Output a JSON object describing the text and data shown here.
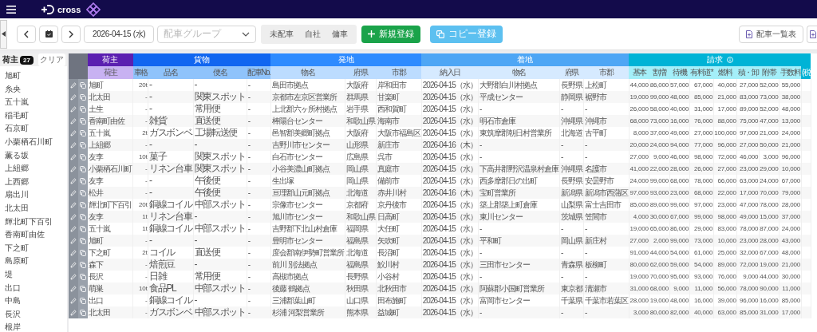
{
  "topbar": {
    "logo_text": "cross"
  },
  "toolbar": {
    "date": "2026-04-15 (水)",
    "group_select": {
      "placeholder": "配車グループ"
    },
    "segments": [
      {
        "label": "未配車",
        "selected": false
      },
      {
        "label": "自社",
        "selected": false
      },
      {
        "label": "傭車",
        "selected": false
      }
    ],
    "new_button": "新規登録",
    "copy_button": "コピー登録",
    "list_button": "配車一覧表"
  },
  "sidebar": {
    "title": "荷主",
    "count": "27",
    "clear_button": "クリア",
    "items": [
      "旭町",
      "糸央",
      "五十嵐",
      "稲毛町",
      "石京町",
      "小栗栖石川町",
      "薫る坂",
      "上組郷",
      "上西郷",
      "扇出川",
      "北太田",
      "輝北町下百引",
      "香南町由佐",
      "下之町",
      "島原町",
      "堤",
      "出口",
      "中島",
      "長沢",
      "根岸"
    ]
  },
  "table": {
    "column_groups": [
      {
        "label": "荷主",
        "kind": "shipper",
        "columns": [
          {
            "label": "荷主",
            "kind": "text"
          }
        ]
      },
      {
        "label": "貨物",
        "kind": "cargo",
        "columns": [
          {
            "label": "車格",
            "kind": "number"
          },
          {
            "label": "品名",
            "kind": "label"
          },
          {
            "label": "便名",
            "kind": "label"
          },
          {
            "label": "配車No.",
            "kind": "text"
          }
        ]
      },
      {
        "label": "発地",
        "kind": "origin",
        "columns": [
          {
            "label": "物名",
            "kind": "text"
          },
          {
            "label": "府県",
            "kind": "text"
          },
          {
            "label": "市郡",
            "kind": "text"
          }
        ]
      },
      {
        "label": "着地",
        "kind": "destination",
        "columns": [
          {
            "label": "納入日",
            "kind": "text"
          },
          {
            "label": "物名",
            "kind": "text"
          },
          {
            "label": "府県",
            "kind": "text"
          },
          {
            "label": "市郡",
            "kind": "text"
          }
        ]
      },
      {
        "label": "請求",
        "kind": "billing",
        "columns": [
          {
            "label": "基本",
            "kind": "number"
          },
          {
            "label": "割増",
            "kind": "number"
          },
          {
            "label": "待機",
            "kind": "number"
          },
          {
            "label": "有料道*",
            "kind": "number"
          },
          {
            "label": "燃料",
            "kind": "number"
          },
          {
            "label": "積・卸",
            "kind": "number"
          },
          {
            "label": "附帯",
            "kind": "number"
          },
          {
            "label": "手数料",
            "kind": "number"
          }
        ]
      }
    ],
    "tax_column": "(税",
    "rows": [
      [
        "旭町",
        "20t",
        "-",
        "-",
        "-",
        "島田市拠点",
        "大阪府",
        "岸和田市",
        "2026-04-15（水）",
        "大野郡白川村拠点",
        "長野県",
        "上松町",
        "44,000",
        "86,000",
        "57,000",
        "67,000",
        "40,000",
        "27,000",
        "52,000",
        "55,000"
      ],
      [
        "北太田",
        "-",
        "-",
        "関東スポット",
        "-",
        "京都市左京区営業所",
        "群馬県",
        "甘楽町",
        "2026-04-15（水）",
        "平成センター",
        "静岡県",
        "裾野市",
        "19,000",
        "99,000",
        "48,000",
        "85,000",
        "21,000",
        "83,000",
        "73,000",
        "38,000"
      ],
      [
        "土生",
        "-",
        "-",
        "常用便",
        "-",
        "上北郡六ヶ所村拠点",
        "岩手県",
        "西和賀町",
        "2026-04-15（水）",
        "-",
        "-",
        "-",
        "26,000",
        "58,000",
        "40,000",
        "31,000",
        "17,000",
        "89,000",
        "52,000",
        "48,000"
      ],
      [
        "香南町由佐",
        "-",
        "雑貨",
        "直送便",
        "-",
        "棒陽台センター",
        "和歌山県",
        "海南市",
        "2026-04-15（水）",
        "明石市倉庫",
        "沖縄県",
        "沖縄市",
        "68,000",
        "73,000",
        "16,000",
        "76,000",
        "88,000",
        "75,000",
        "47,000",
        "13,000"
      ],
      [
        "五十嵐",
        "2t",
        "ガスボンベ",
        "工場転送便",
        "-",
        "邑智郡美郷町拠点",
        "大阪府",
        "大阪市福島区",
        "2026-04-15（水）",
        "東筑摩郡朝日村営業所",
        "北海道",
        "古平町",
        "8,000",
        "37,000",
        "49,000",
        "27,000",
        "100,000",
        "97,000",
        "21,000",
        "24,000"
      ],
      [
        "上組郷",
        "-",
        "-",
        "-",
        "-",
        "吉野川市センター",
        "山形県",
        "新庄市",
        "2026-04-16（木）",
        "-",
        "-",
        "-",
        "20,000",
        "24,000",
        "94,000",
        "77,000",
        "96,000",
        "27,000",
        "50,000",
        "21,000"
      ],
      [
        "友李",
        "10t",
        "菓子",
        "関東スポット",
        "-",
        "白石市センター",
        "広島県",
        "呉市",
        "2026-04-15（水）",
        "-",
        "-",
        "-",
        "27,000",
        "9,000",
        "46,000",
        "98,000",
        "72,000",
        "46,000",
        "3,000",
        "96,000"
      ],
      [
        "小栗栖石川町",
        "-",
        "リネン台車",
        "関東スポット",
        "-",
        "小谷美濃山町拠点",
        "岡山県",
        "真庭市",
        "2026-04-15（水）",
        "下高井郡野沢温泉村倉庫",
        "沖縄県",
        "名護市",
        "41,000",
        "22,000",
        "28,000",
        "26,000",
        "27,000",
        "23,000",
        "29,000",
        "10,000"
      ],
      [
        "友李",
        "-",
        "-",
        "午後便",
        "-",
        "生出塚",
        "岡山県",
        "備前市",
        "2026-04-15（水）",
        "西多摩郡日の出町",
        "長野県",
        "安曇野市",
        "24,000",
        "99,000",
        "68,000",
        "78,000",
        "66,000",
        "63,000",
        "24,000",
        "67,000"
      ],
      [
        "松井",
        "-",
        "-",
        "午後便",
        "-",
        "亘理郡山元町拠点",
        "北海道",
        "赤井川村",
        "2026-04-16（木）",
        "宝町営業所",
        "新潟県",
        "新潟市西蒲区",
        "97,000",
        "93,000",
        "23,000",
        "68,000",
        "22,000",
        "17,000",
        "70,000",
        "79,000"
      ],
      [
        "輝北町下百引",
        "20t",
        "銅線コイル",
        "中部スポット",
        "-",
        "宗像市センター",
        "京都府",
        "京丹後市",
        "2026-04-15（水）",
        "築上郡築上町倉庫",
        "山梨県",
        "富士吉田市",
        "85,000",
        "89,000",
        "99,000",
        "97,000",
        "23,000",
        "47,000",
        "78,000",
        "28,000"
      ],
      [
        "友李",
        "1t",
        "リネン台車",
        "-",
        "-",
        "旭川市センター",
        "和歌山県",
        "日高町",
        "2026-04-15（水）",
        "東川センター",
        "茨城県",
        "笠間市",
        "4,000",
        "30,000",
        "67,000",
        "99,000",
        "98,000",
        "49,000",
        "15,000",
        "37,000"
      ],
      [
        "五十嵐",
        "1t",
        "銅線コイル",
        "中部スポット",
        "-",
        "吉野郡下北山村倉庫",
        "福岡県",
        "大任町",
        "2026-04-15（水）",
        "-",
        "-",
        "-",
        "19,000",
        "65,000",
        "86,000",
        "29,000",
        "83,000",
        "78,000",
        "87,000",
        "24,000"
      ],
      [
        "旭町",
        "-",
        "-",
        "-",
        "-",
        "豊明市センター",
        "福島県",
        "矢吹町",
        "2026-04-15（水）",
        "平和町",
        "岡山県",
        "新庄村",
        "27,000",
        "2,000",
        "99,000",
        "73,000",
        "10,000",
        "23,000",
        "28,000",
        "43,000"
      ],
      [
        "下之町",
        "2t",
        "コイル",
        "直送便",
        "-",
        "度会郡南伊勢町営業所",
        "北海道",
        "長沼町",
        "2026-04-15（水）",
        "-",
        "-",
        "-",
        "91,000",
        "44,000",
        "54,000",
        "61,000",
        "25,000",
        "32,000",
        "67,000",
        "48,000"
      ],
      [
        "森下",
        "-",
        "焙煎豆",
        "-",
        "-",
        "前川 別法拠点",
        "福島県",
        "鮫川村",
        "2026-04-15（水）",
        "三田市センター",
        "青森県",
        "板柳町",
        "80,000",
        "62,000",
        "59,000",
        "54,000",
        "89,000",
        "72,000",
        "19,000",
        "21,000"
      ],
      [
        "長沢",
        "-",
        "日雑",
        "常用便",
        "-",
        "高槻市拠点",
        "長野県",
        "小谷村",
        "2026-04-15（水）",
        "-",
        "-",
        "-",
        "19,000",
        "70,000",
        "95,000",
        "93,000",
        "76,000",
        "9,000",
        "44,000",
        "30,000"
      ],
      [
        "萌巣",
        "10t",
        "食品PL",
        "中部スポット",
        "-",
        "後藤 鶴拠点",
        "秋田県",
        "北秋田市",
        "2026-04-15（水）",
        "阿蘇郡小国町営業所",
        "東京都",
        "清瀬市",
        "31,000",
        "68,000",
        "9,000",
        "11,000",
        "56,000",
        "78,000",
        "90,000",
        "11,000"
      ],
      [
        "出口",
        "-",
        "銅線コイル",
        "-",
        "-",
        "三浦郡葉山町",
        "山口県",
        "田布施町",
        "2026-04-15（水）",
        "富岡市センター",
        "千葉県",
        "千葉市若葉区",
        "28,000",
        "19,000",
        "48,000",
        "16,000",
        "39,000",
        "96,000",
        "16,000",
        "85,000"
      ],
      [
        "北太田",
        "-",
        "ガスボンベ",
        "中部スポット",
        "-",
        "杉浦 河梨営業所",
        "熊本県",
        "益城町",
        "2026-04-15（水）",
        "-",
        "-",
        "-",
        "3,000",
        "80,000",
        "82,000",
        "40,000",
        "63,000",
        "85,000",
        "31,000",
        "17,000"
      ]
    ]
  }
}
